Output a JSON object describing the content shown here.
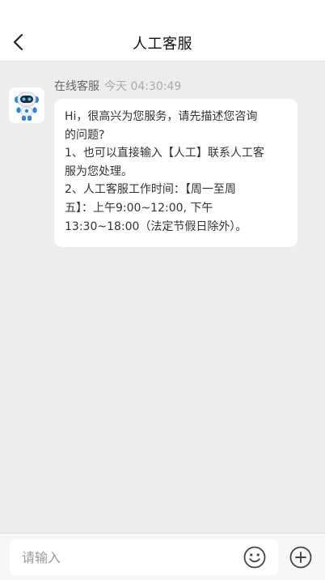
{
  "header": {
    "title": "人工客服",
    "back_icon": "chevron-left-icon"
  },
  "message": {
    "sender": "在线客服",
    "time": "今天 04:30:49",
    "avatar_icon": "robot-avatar-icon",
    "text": "Hi，很高兴为您服务，请先描述您咨询\n的问题?\n1、也可以直接输入【人工】联系人工客\n服为您处理。\n2、人工客服工作时间：【周一至周\n五】：上午9:00~12:00, 下午\n13:30~18:00（法定节假日除外）。"
  },
  "input": {
    "placeholder": "请输入",
    "value": "",
    "emoji_icon": "emoji-icon",
    "plus_icon": "plus-circle-icon"
  },
  "colors": {
    "page_bg": "#ededed",
    "header_bg": "#ffffff",
    "bubble_bg": "#ffffff",
    "avatar_accent": "#2f86d8"
  }
}
